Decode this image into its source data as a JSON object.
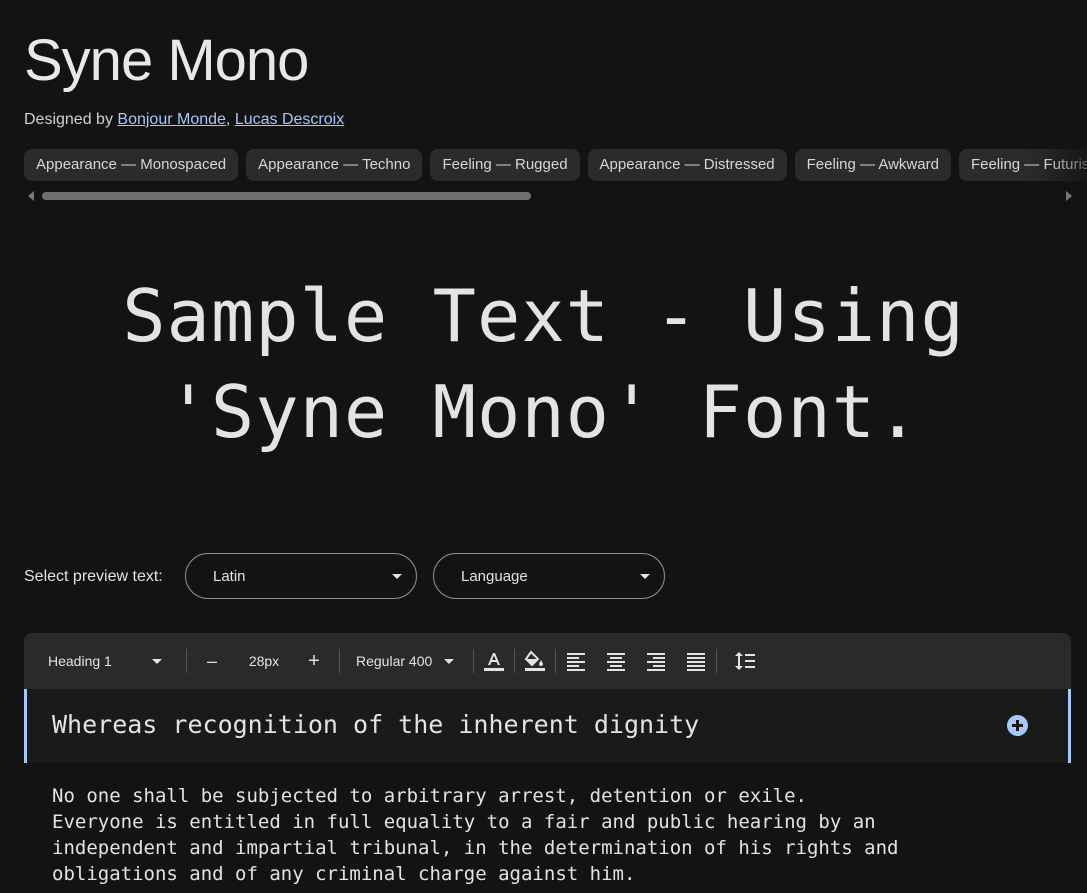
{
  "font": {
    "name": "Syne Mono",
    "designed_by_label": "Designed by",
    "separator": ",",
    "designers": [
      "Bonjour Monde",
      "Lucas Descroix"
    ]
  },
  "tags": [
    "Appearance — Monospaced",
    "Appearance — Techno",
    "Feeling — Rugged",
    "Appearance — Distressed",
    "Feeling — Awkward",
    "Feeling — Futuristic"
  ],
  "sample": {
    "line1": "Sample Text - Using",
    "line2": "'Syne Mono' Font."
  },
  "preview": {
    "label": "Select preview text:",
    "script_value": "Latin",
    "language_placeholder": "Language"
  },
  "toolbar": {
    "style": "Heading 1",
    "decrease": "–",
    "size": "28px",
    "increase": "+",
    "weight": "Regular 400",
    "icons": [
      "text-color-icon",
      "highlight-color-icon",
      "align-left-icon",
      "align-center-icon",
      "align-right-icon",
      "align-justify-icon",
      "line-height-icon"
    ]
  },
  "editor": {
    "heading": "Whereas recognition of the inherent dignity",
    "body_lines": [
      "No one shall be subjected to arbitrary arrest, detention or exile.",
      "Everyone is entitled in full equality to a fair and public hearing by an",
      "independent and impartial tribunal, in the determination of his rights and",
      "obligations and of any criminal charge against him."
    ]
  },
  "colors": {
    "background": "#131313",
    "accent": "#a8c7fa",
    "chip": "#2b2b2b",
    "toolbar": "#2a2a2a"
  }
}
